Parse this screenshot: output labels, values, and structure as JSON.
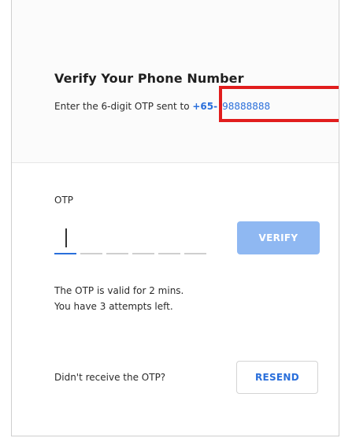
{
  "header": {
    "title": "Verify Your Phone Number",
    "subtitle_prefix": "Enter the 6-digit OTP sent to ",
    "country_code": "+65-",
    "phone_number": "98888888"
  },
  "otp": {
    "label": "OTP",
    "value": "",
    "placeholder": "",
    "digit_count": 6,
    "verify_label": "VERIFY"
  },
  "info": {
    "validity": "The OTP is valid for 2 mins.",
    "attempts": "You have 3 attempts left."
  },
  "resend": {
    "question": "Didn't receive the OTP?",
    "button_label": "RESEND"
  },
  "colors": {
    "accent": "#2a6fdb",
    "verify_disabled": "#8fb8f2",
    "highlight": "#e11d1d"
  }
}
